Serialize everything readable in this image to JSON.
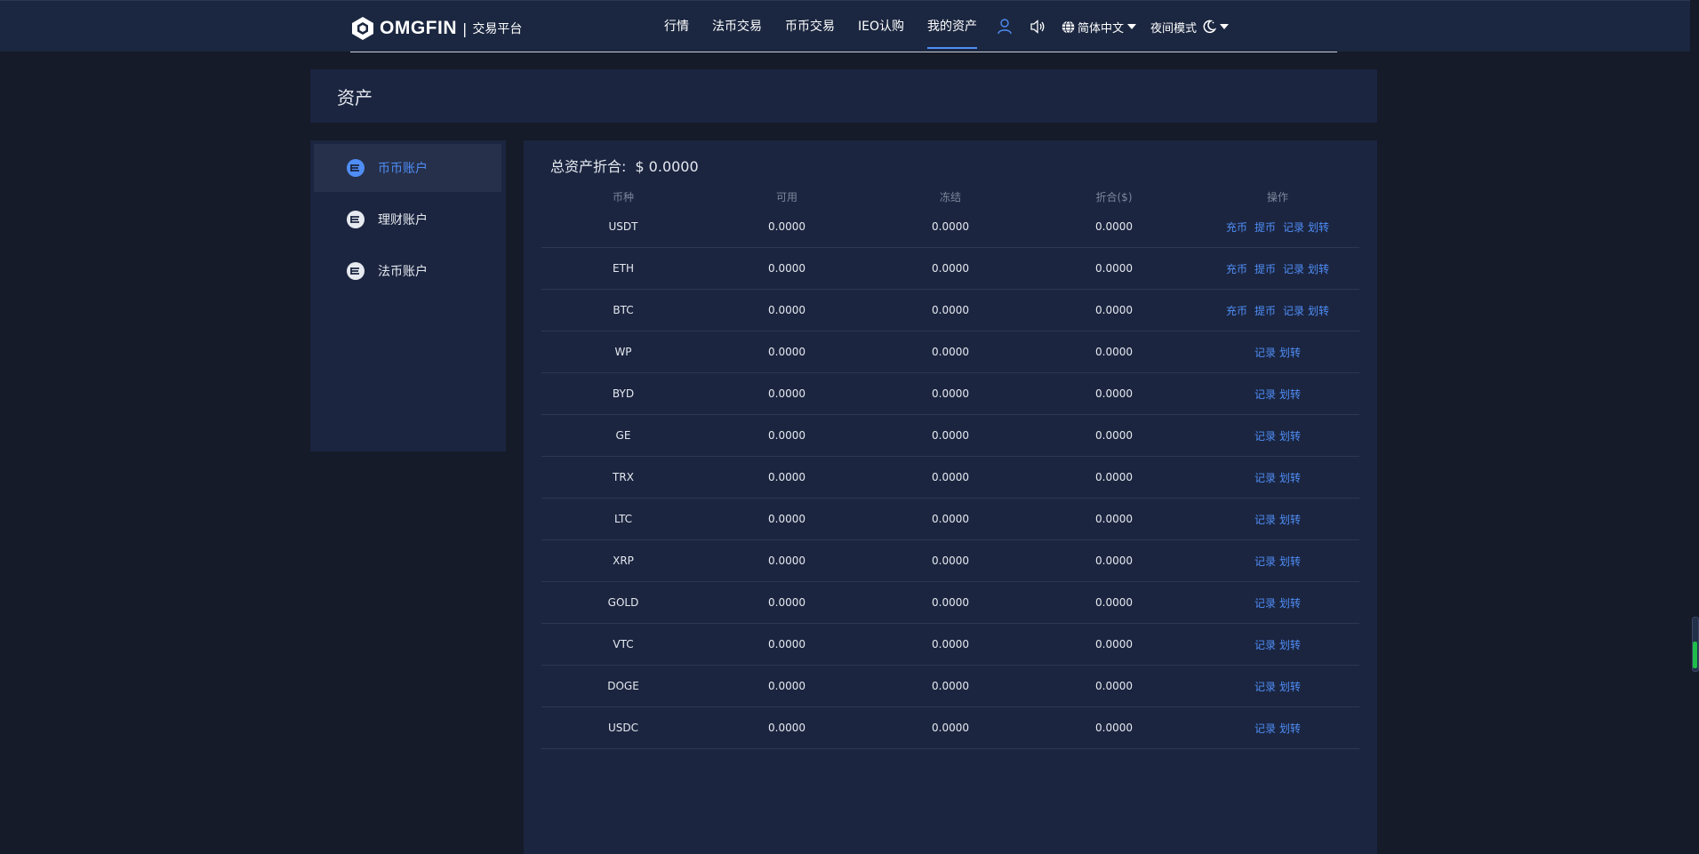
{
  "header": {
    "logo_text": "OMGFIN",
    "logo_separator": "|",
    "logo_subtitle": "交易平台",
    "nav": [
      "行情",
      "法币交易",
      "币币交易",
      "IEO认购",
      "我的资产"
    ],
    "active_nav": "我的资产",
    "language": "简体中文",
    "night_mode": "夜间模式"
  },
  "page": {
    "title": "资产"
  },
  "sidebar": {
    "items": [
      {
        "label": "币币账户",
        "active": true
      },
      {
        "label": "理财账户",
        "active": false
      },
      {
        "label": "法币账户",
        "active": false
      }
    ]
  },
  "main": {
    "total_label": "总资产折合:",
    "total_value": "$ 0.0000",
    "columns": [
      "币种",
      "可用",
      "冻结",
      "折合($)",
      "操作"
    ],
    "rows": [
      {
        "coin": "USDT",
        "available": "0.0000",
        "frozen": "0.0000",
        "value": "0.0000",
        "ops": [
          "充币",
          "提币",
          "记录",
          "划转"
        ]
      },
      {
        "coin": "ETH",
        "available": "0.0000",
        "frozen": "0.0000",
        "value": "0.0000",
        "ops": [
          "充币",
          "提币",
          "记录",
          "划转"
        ]
      },
      {
        "coin": "BTC",
        "available": "0.0000",
        "frozen": "0.0000",
        "value": "0.0000",
        "ops": [
          "充币",
          "提币",
          "记录",
          "划转"
        ]
      },
      {
        "coin": "WP",
        "available": "0.0000",
        "frozen": "0.0000",
        "value": "0.0000",
        "ops": [
          "记录",
          "划转"
        ]
      },
      {
        "coin": "BYD",
        "available": "0.0000",
        "frozen": "0.0000",
        "value": "0.0000",
        "ops": [
          "记录",
          "划转"
        ]
      },
      {
        "coin": "GE",
        "available": "0.0000",
        "frozen": "0.0000",
        "value": "0.0000",
        "ops": [
          "记录",
          "划转"
        ]
      },
      {
        "coin": "TRX",
        "available": "0.0000",
        "frozen": "0.0000",
        "value": "0.0000",
        "ops": [
          "记录",
          "划转"
        ]
      },
      {
        "coin": "LTC",
        "available": "0.0000",
        "frozen": "0.0000",
        "value": "0.0000",
        "ops": [
          "记录",
          "划转"
        ]
      },
      {
        "coin": "XRP",
        "available": "0.0000",
        "frozen": "0.0000",
        "value": "0.0000",
        "ops": [
          "记录",
          "划转"
        ]
      },
      {
        "coin": "GOLD",
        "available": "0.0000",
        "frozen": "0.0000",
        "value": "0.0000",
        "ops": [
          "记录",
          "划转"
        ]
      },
      {
        "coin": "VTC",
        "available": "0.0000",
        "frozen": "0.0000",
        "value": "0.0000",
        "ops": [
          "记录",
          "划转"
        ]
      },
      {
        "coin": "DOGE",
        "available": "0.0000",
        "frozen": "0.0000",
        "value": "0.0000",
        "ops": [
          "记录",
          "划转"
        ]
      },
      {
        "coin": "USDC",
        "available": "0.0000",
        "frozen": "0.0000",
        "value": "0.0000",
        "ops": [
          "记录",
          "划转"
        ]
      }
    ]
  },
  "icons": {
    "logo": "omgfin-logo-icon",
    "user": "user-icon",
    "sound": "speaker-icon",
    "language": "globe-icon",
    "night": "moon-icon",
    "account": "coin-stack-icon"
  },
  "colors": {
    "accent": "#4f8df5",
    "background": "#151b28",
    "panel": "#1b2540",
    "topbar": "#1b2740"
  }
}
